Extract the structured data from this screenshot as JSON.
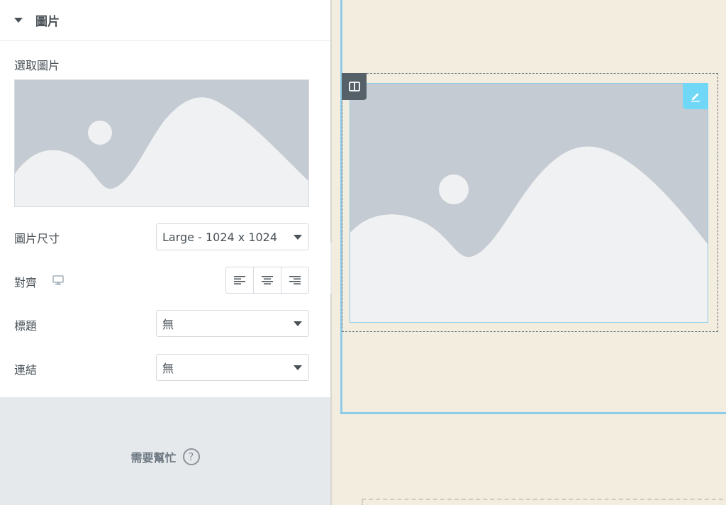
{
  "panel": {
    "section_title": "圖片",
    "choose_image_label": "選取圖片",
    "image_size": {
      "label": "圖片尺寸",
      "value": "Large - 1024 x 1024"
    },
    "alignment": {
      "label": "對齊",
      "options": [
        "left",
        "center",
        "right"
      ]
    },
    "caption": {
      "label": "標題",
      "value": "無"
    },
    "link": {
      "label": "連結",
      "value": "無"
    },
    "help": {
      "text": "需要幫忙",
      "icon_text": "?"
    }
  },
  "colors": {
    "placeholder_bg": "#c5cbd2",
    "placeholder_hill": "#f0f1f3",
    "selection_outline": "#8ecbe8",
    "edit_handle": "#71d7f7",
    "canvas_bg": "#f3ede0"
  },
  "icons": {
    "section_toggle": "caret-down-icon",
    "responsive": "desktop-monitor-icon",
    "collapse": "chevron-left-icon",
    "column": "column-layout-icon",
    "edit": "pencil-icon"
  }
}
